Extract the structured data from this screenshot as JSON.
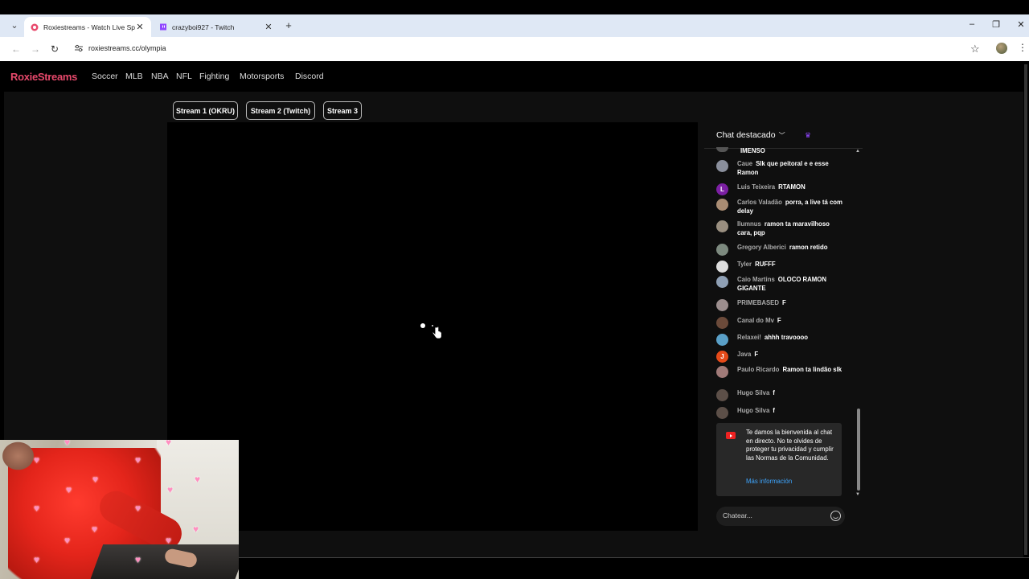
{
  "browser": {
    "tabs": [
      {
        "title": "Roxiestreams - Watch Live Spor",
        "active": true
      },
      {
        "title": "crazyboi927 - Twitch",
        "active": false
      }
    ],
    "url": "roxiestreams.cc/olympia"
  },
  "site": {
    "brand": "RoxieStreams",
    "brand_color": "#e8496c",
    "nav": [
      "Soccer",
      "MLB",
      "NBA",
      "NFL",
      "Fighting",
      "Motorsports",
      "Discord"
    ]
  },
  "streams": [
    "Stream 1 (OKRU)",
    "Stream 2 (Twitch)",
    "Stream 3"
  ],
  "chat": {
    "header": "Chat destacado",
    "messages": [
      {
        "author": "",
        "text": "IMENSO",
        "avatar": "#555"
      },
      {
        "author": "Caue",
        "text": "Slk que peitoral e e esse Ramon",
        "avatar": "#8a8f9c"
      },
      {
        "author": "Luis Teixeira",
        "text": "RTAMON",
        "avatar": "#7b1fa2",
        "initial": "L"
      },
      {
        "author": "Carlos Valadão",
        "text": "porra, a live tá com delay",
        "avatar": "#a98c73"
      },
      {
        "author": "Ilumnus",
        "text": "ramon ta maravilhoso cara, pqp",
        "avatar": "#9a8f80"
      },
      {
        "author": "Gregory Alberici",
        "text": "ramon retido",
        "avatar": "#7d8a7f"
      },
      {
        "author": "Tyler",
        "text": "RUFFF",
        "avatar": "#ddd"
      },
      {
        "author": "Caio Martins",
        "text": "OLOCO RAMON GIGANTE",
        "avatar": "#8fa0b5"
      },
      {
        "author": "PRIMEBASED",
        "text": "F",
        "avatar": "#9c8e8e"
      },
      {
        "author": "Canal do Mv",
        "text": "F",
        "avatar": "#6b4a3a"
      },
      {
        "author": "Relaxei!",
        "text": "ahhh travoooo",
        "avatar": "#5aa0c8"
      },
      {
        "author": "Java",
        "text": "F",
        "avatar": "#e64a19",
        "initial": "J"
      },
      {
        "author": "Paulo Ricardo",
        "text": "Ramon ta lindão slk",
        "avatar": "#a07a78"
      },
      {
        "author": "Hugo Silva",
        "text": "f",
        "avatar": "#5c4f48"
      },
      {
        "author": "Hugo Silva",
        "text": "f",
        "avatar": "#5c4f48"
      }
    ],
    "notice": "Te damos la bienvenida al chat en directo. No te olvides de proteger tu privacidad y cumplir las Normas de la Comunidad.",
    "notice_link": "Más información",
    "input_placeholder": "Chatear..."
  }
}
